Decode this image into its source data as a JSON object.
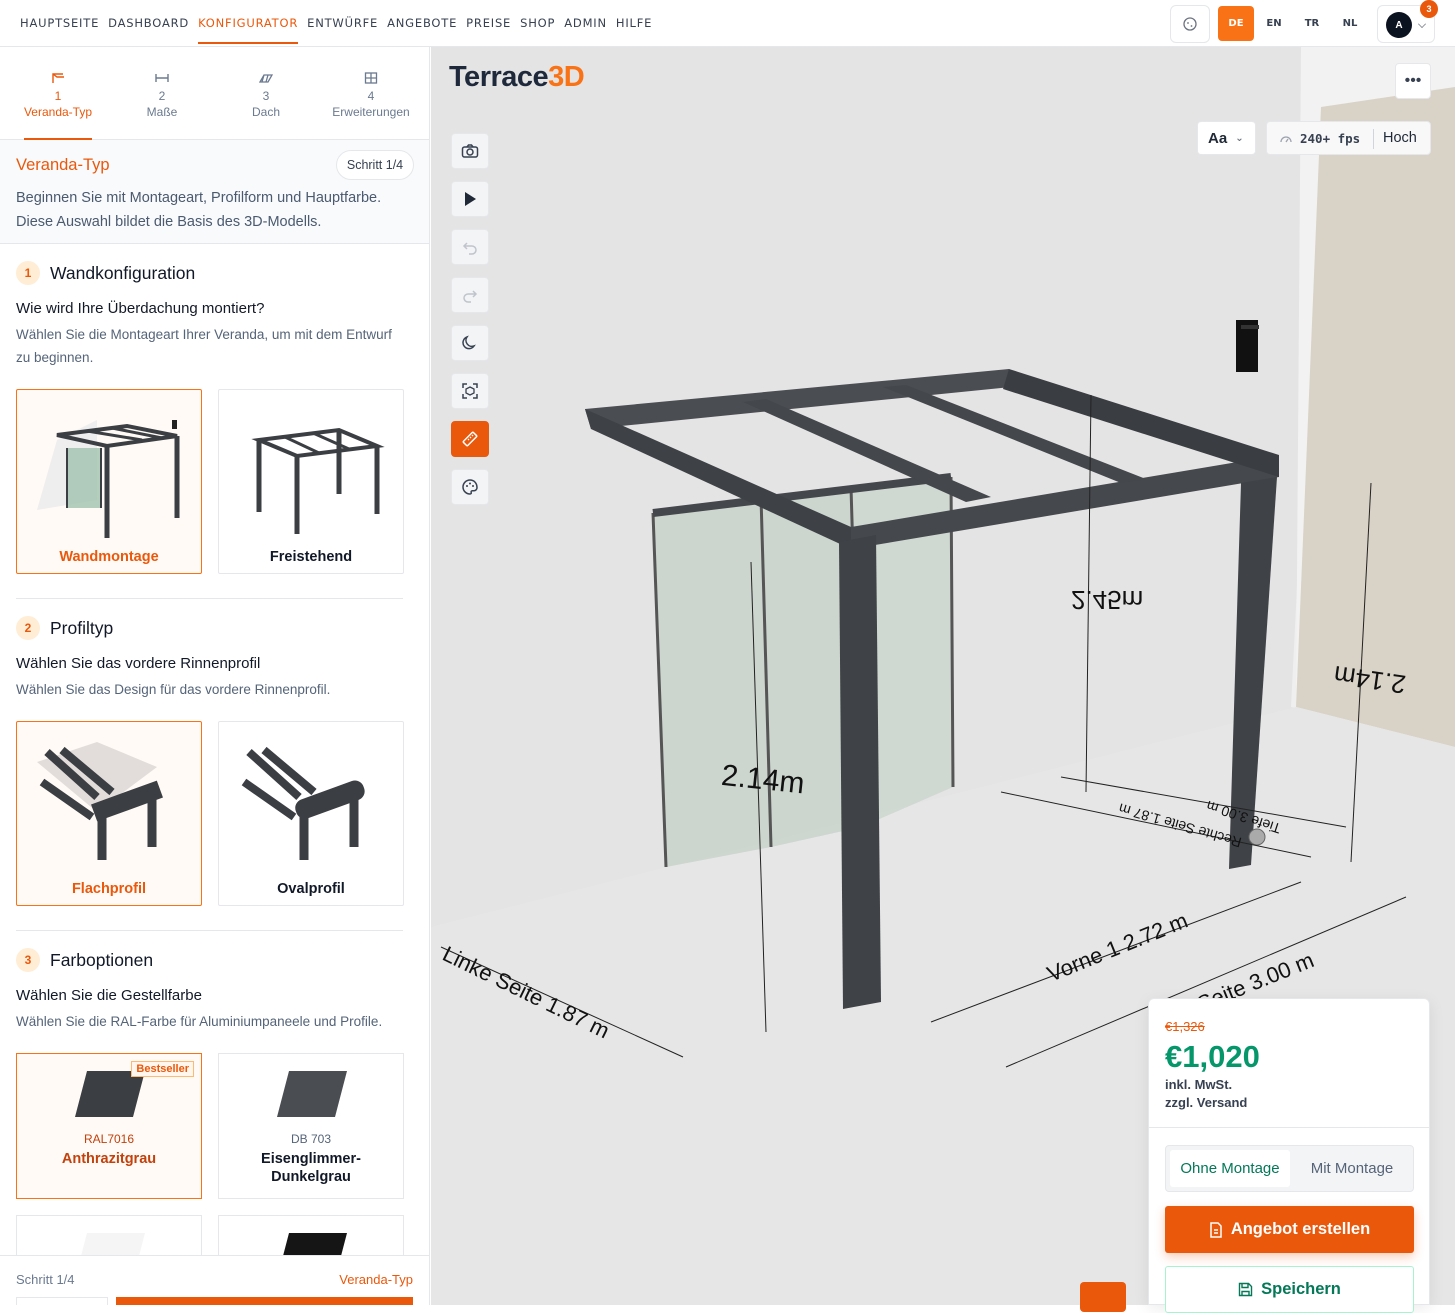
{
  "nav": [
    "HAUPTSEITE",
    "DASHBOARD",
    "KONFIGURATOR",
    "ENTWÜRFE",
    "ANGEBOTE",
    "PREISE",
    "SHOP",
    "ADMIN",
    "HILFE"
  ],
  "nav_active": "KONFIGURATOR",
  "languages": [
    "DE",
    "EN",
    "TR",
    "NL"
  ],
  "language_active": "DE",
  "user": {
    "initial": "A",
    "notifications": "3"
  },
  "steps": [
    {
      "num": "1",
      "label": "Veranda-Typ"
    },
    {
      "num": "2",
      "label": "Maße"
    },
    {
      "num": "3",
      "label": "Dach"
    },
    {
      "num": "4",
      "label": "Erweiterungen"
    }
  ],
  "intro": {
    "title": "Veranda-Typ",
    "badge": "Schritt 1/4",
    "description": "Beginnen Sie mit Montageart, Profilform und Hauptfarbe. Diese Auswahl bildet die Basis des 3D-Modells."
  },
  "sections": [
    {
      "num": "1",
      "title": "Wandkonfiguration",
      "question": "Wie wird Ihre Überdachung montiert?",
      "hint": "Wählen Sie die Montageart Ihrer Veranda, um mit dem Entwurf zu beginnen.",
      "options": [
        "Wandmontage",
        "Freistehend"
      ]
    },
    {
      "num": "2",
      "title": "Profiltyp",
      "question": "Wählen Sie das vordere Rinnenprofil",
      "hint": "Wählen Sie das Design für das vordere Rinnenprofil.",
      "options": [
        "Flachprofil",
        "Ovalprofil"
      ]
    },
    {
      "num": "3",
      "title": "Farboptionen",
      "question": "Wählen Sie die Gestellfarbe",
      "hint": "Wählen Sie die RAL-Farbe für Aluminiumpaneele und Profile."
    }
  ],
  "colors": [
    {
      "code": "RAL7016",
      "name": "Anthrazitgrau",
      "badge": "Bestseller",
      "hex": "#3b3e42"
    },
    {
      "code": "DB 703",
      "name": "Eisenglimmer-Dunkelgrau",
      "hex": "#4a4d52"
    }
  ],
  "sidebar_footer": {
    "step": "Schritt 1/4",
    "value": "Veranda-Typ"
  },
  "viewport": {
    "logo_part1": "Terrace",
    "logo_part2": "3D",
    "font_button": "Aa",
    "fps": "240+ fps",
    "quality": "Hoch",
    "dimensions": {
      "roof_height": "2.45m",
      "front_right_height": "2.14m",
      "front_left_height": "2.14m",
      "left_side": "Linke Seite 1.87 m",
      "front1": "Vorne 1 2.72 m",
      "front_total": "Seite 3.00 m",
      "right_side": "Rechte Seite 1.87 m",
      "depth": "Tiefe 3.00 m"
    }
  },
  "pricing": {
    "old_price": "€1,326",
    "price": "€1,020",
    "vat": "inkl. MwSt.",
    "shipping": "zzgl. Versand",
    "mount_options": [
      "Ohne Montage",
      "Mit Montage"
    ],
    "offer_button": "Angebot erstellen",
    "save_button": "Speichern"
  }
}
